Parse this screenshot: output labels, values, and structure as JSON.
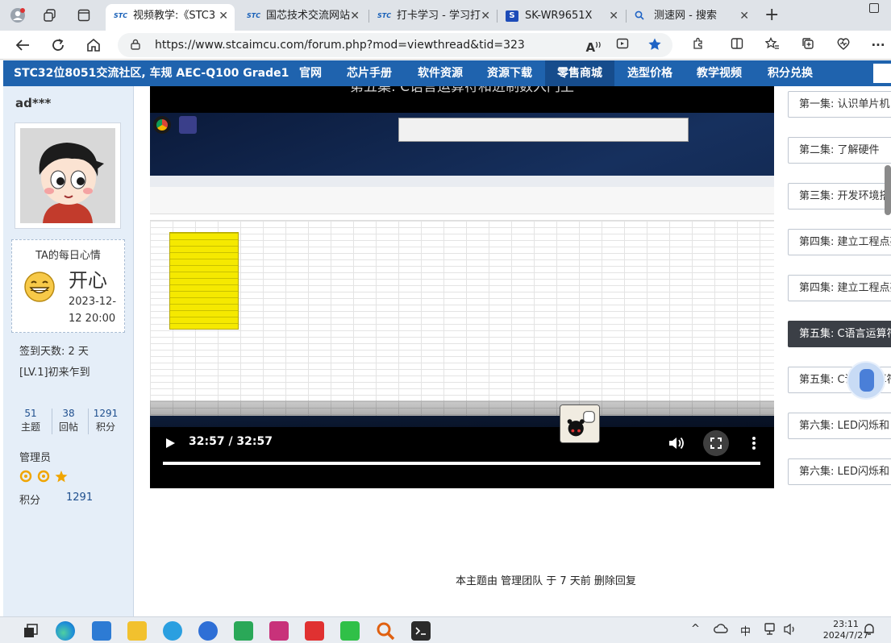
{
  "browser": {
    "tabs": [
      {
        "label": "视频教学:《STC3",
        "favicon": "stc-logo"
      },
      {
        "label": "国芯技术交流网站",
        "favicon": "stc-logo"
      },
      {
        "label": "打卡学习 - 学习打",
        "favicon": "stc-logo"
      },
      {
        "label": "SK-WR9651X",
        "favicon": "s-logo"
      },
      {
        "label": "测速网 - 搜索",
        "favicon": "search-icon"
      }
    ],
    "url": "https://www.stcaimcu.com/forum.php?mod=viewthread&tid=323"
  },
  "site": {
    "brand": "STC32位8051交流社区, 车规 AEC-Q100 Grade1",
    "nav": [
      "官网",
      "芯片手册",
      "软件资源",
      "资源下载",
      "零售商城",
      "选型价格",
      "教学视频",
      "积分兑换"
    ],
    "active_nav": "零售商城"
  },
  "user": {
    "name": "ad***",
    "mood_title": "TA的每日心情",
    "mood": "开心",
    "mood_time": "2023-12-12 20:00",
    "signin": "签到天数: 2 天",
    "level": "[LV.1]初来乍到",
    "stats": [
      {
        "value": "51",
        "label": "主题"
      },
      {
        "value": "38",
        "label": "回帖"
      },
      {
        "value": "1291",
        "label": "积分"
      }
    ],
    "role": "管理员",
    "score_label": "积分",
    "score_value": "1291"
  },
  "video": {
    "title": "第五集: C语言运算符和进制数入门上",
    "time": "32:57 / 32:57",
    "progress": 1.0
  },
  "episodes": [
    {
      "label": "第一集: 认识单片机",
      "active": false
    },
    {
      "label": "第二集: 了解硬件",
      "active": false
    },
    {
      "label": "第三集: 开发环境搭建",
      "active": false
    },
    {
      "label": "第四集: 建立工程点亮",
      "active": false
    },
    {
      "label": "第四集: 建立工程点亮",
      "active": false
    },
    {
      "label": "第五集: C语言运算符",
      "active": true
    },
    {
      "label": "第五集: C语言运算符",
      "active": false
    },
    {
      "label": "第六集: LED闪烁和",
      "active": false
    },
    {
      "label": "第六集: LED闪烁和",
      "active": false
    }
  ],
  "footer_note": "本主题由 管理团队 于 7 天前 删除回复",
  "taskbar": {
    "ime": "中",
    "time": "23:11",
    "date": "2024/7/27"
  },
  "colors": {
    "site_nav": "#1f63ae",
    "user_column": "#e5eef8",
    "episode_active": "#3b3f46",
    "highlight_cells": "#f5e900"
  }
}
